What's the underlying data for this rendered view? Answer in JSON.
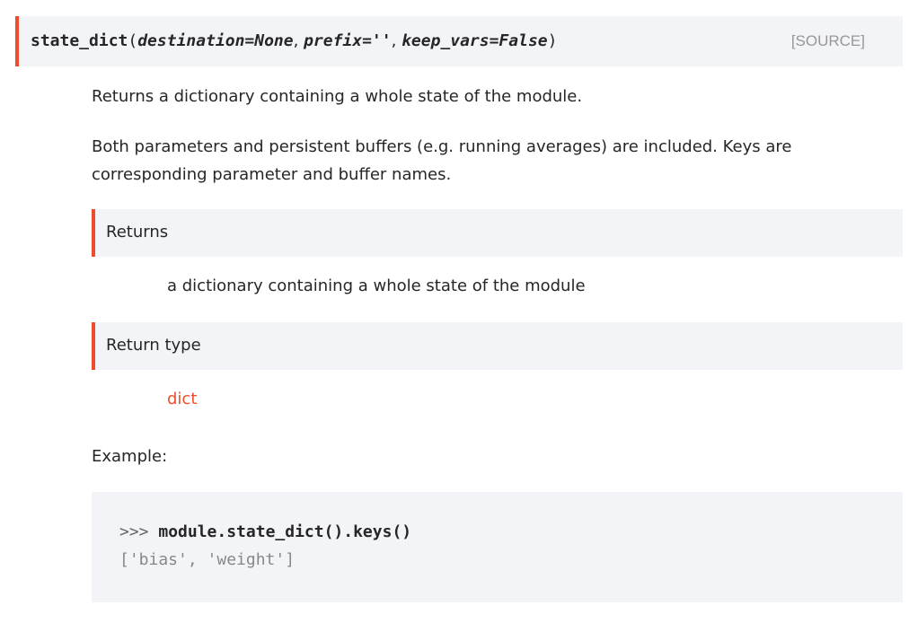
{
  "signature": {
    "name": "state_dict",
    "open_paren": "(",
    "params": [
      {
        "text": "destination=None"
      },
      {
        "text": "prefix=''"
      },
      {
        "text": "keep_vars=False"
      }
    ],
    "separator": ", ",
    "close_paren": ")",
    "source_link": "[SOURCE]"
  },
  "description": {
    "summary": "Returns a dictionary containing a whole state of the module.",
    "details": "Both parameters and persistent buffers (e.g. running averages) are included. Keys are corresponding parameter and buffer names."
  },
  "fields": {
    "returns": {
      "label": "Returns",
      "value": "a dictionary containing a whole state of the module"
    },
    "return_type": {
      "label": "Return type",
      "value": "dict"
    }
  },
  "example": {
    "label": "Example:",
    "prompt": ">>> ",
    "command": "module.state_dict().keys()",
    "output": "['bias', 'weight']"
  },
  "colors": {
    "accent": "#ee4c2c",
    "block_background": "#f3f4f7",
    "text": "#262626",
    "muted": "#979797"
  }
}
